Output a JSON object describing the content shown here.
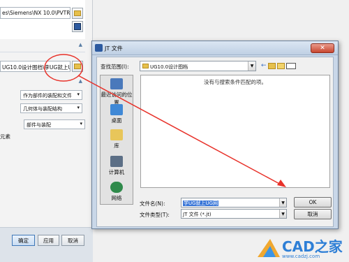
{
  "nx_dialog": {
    "path_value": "es\\Siemens\\NX 10.0\\PVTRA",
    "name_value": "UG10.0设计图档\\李UG就上UC",
    "select1": "作为部件的装配和文件",
    "select2": "几何体与装配结构",
    "select3": "部件与装配",
    "label_partial": "元素",
    "ok_label": "确定",
    "apply_label": "应用",
    "cancel_label": "取消"
  },
  "jt_dialog": {
    "title": "JT 文件",
    "close_symbol": "✕",
    "lookin_label": "查找范围(I):",
    "lookin_value": "UG10.0设计图档",
    "empty_message": "没有与搜索条件匹配的项。",
    "places": [
      {
        "label": "最近访问的位置",
        "icon": "recent-places-icon"
      },
      {
        "label": "桌面",
        "icon": "desktop-icon"
      },
      {
        "label": "库",
        "icon": "library-icon"
      },
      {
        "label": "计算机",
        "icon": "computer-icon"
      },
      {
        "label": "网络",
        "icon": "network-icon"
      }
    ],
    "filename_label": "文件名(N):",
    "filename_value": "学UG就上UG网",
    "filetype_label": "文件类型(T):",
    "filetype_value": "JT 文件 (*.jt)",
    "ok_label": "OK",
    "cancel_label": "取消"
  },
  "watermark": {
    "text": "CAD之家",
    "url": "www.cadzj.com"
  },
  "colors": {
    "annotation": "#e8322a",
    "accent_blue": "#3875d7"
  }
}
